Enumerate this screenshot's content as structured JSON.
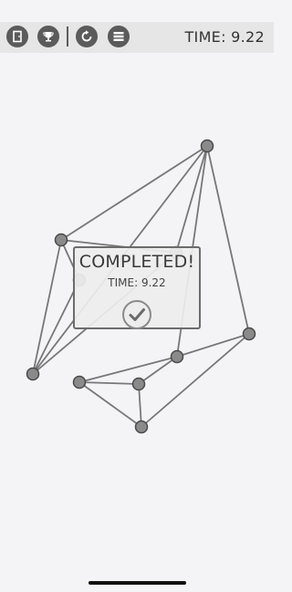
{
  "toolbar": {
    "buttons": [
      {
        "icon": "exit-door-icon"
      },
      {
        "icon": "trophy-icon"
      },
      {
        "icon": "restart-icon"
      },
      {
        "icon": "menu-icon"
      }
    ],
    "timer_text": "TIME: 9.22"
  },
  "dialog": {
    "title": "COMPLETED!",
    "time_text": "TIME: 9.22",
    "confirm_icon": "checkmark-icon"
  },
  "colors": {
    "background": "#f4f3f6",
    "toolbar": "#e6e6e6",
    "icon": "#5b5b5b",
    "node_fill": "#8a8a8a",
    "node_stroke": "#4a4a4a",
    "edge": "#777777"
  }
}
